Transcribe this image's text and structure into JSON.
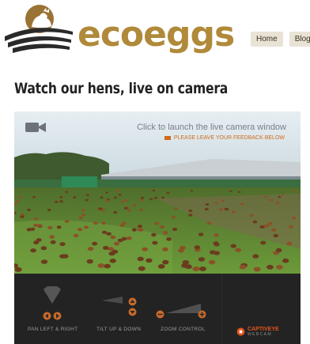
{
  "brand": {
    "name": "ecoeggs"
  },
  "nav": {
    "items": [
      {
        "label": "Home"
      },
      {
        "label": "Blog"
      }
    ]
  },
  "page": {
    "title": "Watch our hens, live on camera"
  },
  "camera": {
    "launch_text": "Click to launch the live camera window",
    "feedback_text": "PLEASE LEAVE YOUR FEEDBACK BELOW"
  },
  "controls": {
    "pan_label": "PAN LEFT & RIGHT",
    "tilt_label": "TILT UP & DOWN",
    "zoom_label": "ZOOM CONTROL",
    "brand_name": "CAPTIVEYE",
    "brand_sub": "WEBCAM"
  },
  "colors": {
    "brand": "#b08a3a",
    "accent": "#e2541e",
    "controls_bg": "#232323"
  }
}
